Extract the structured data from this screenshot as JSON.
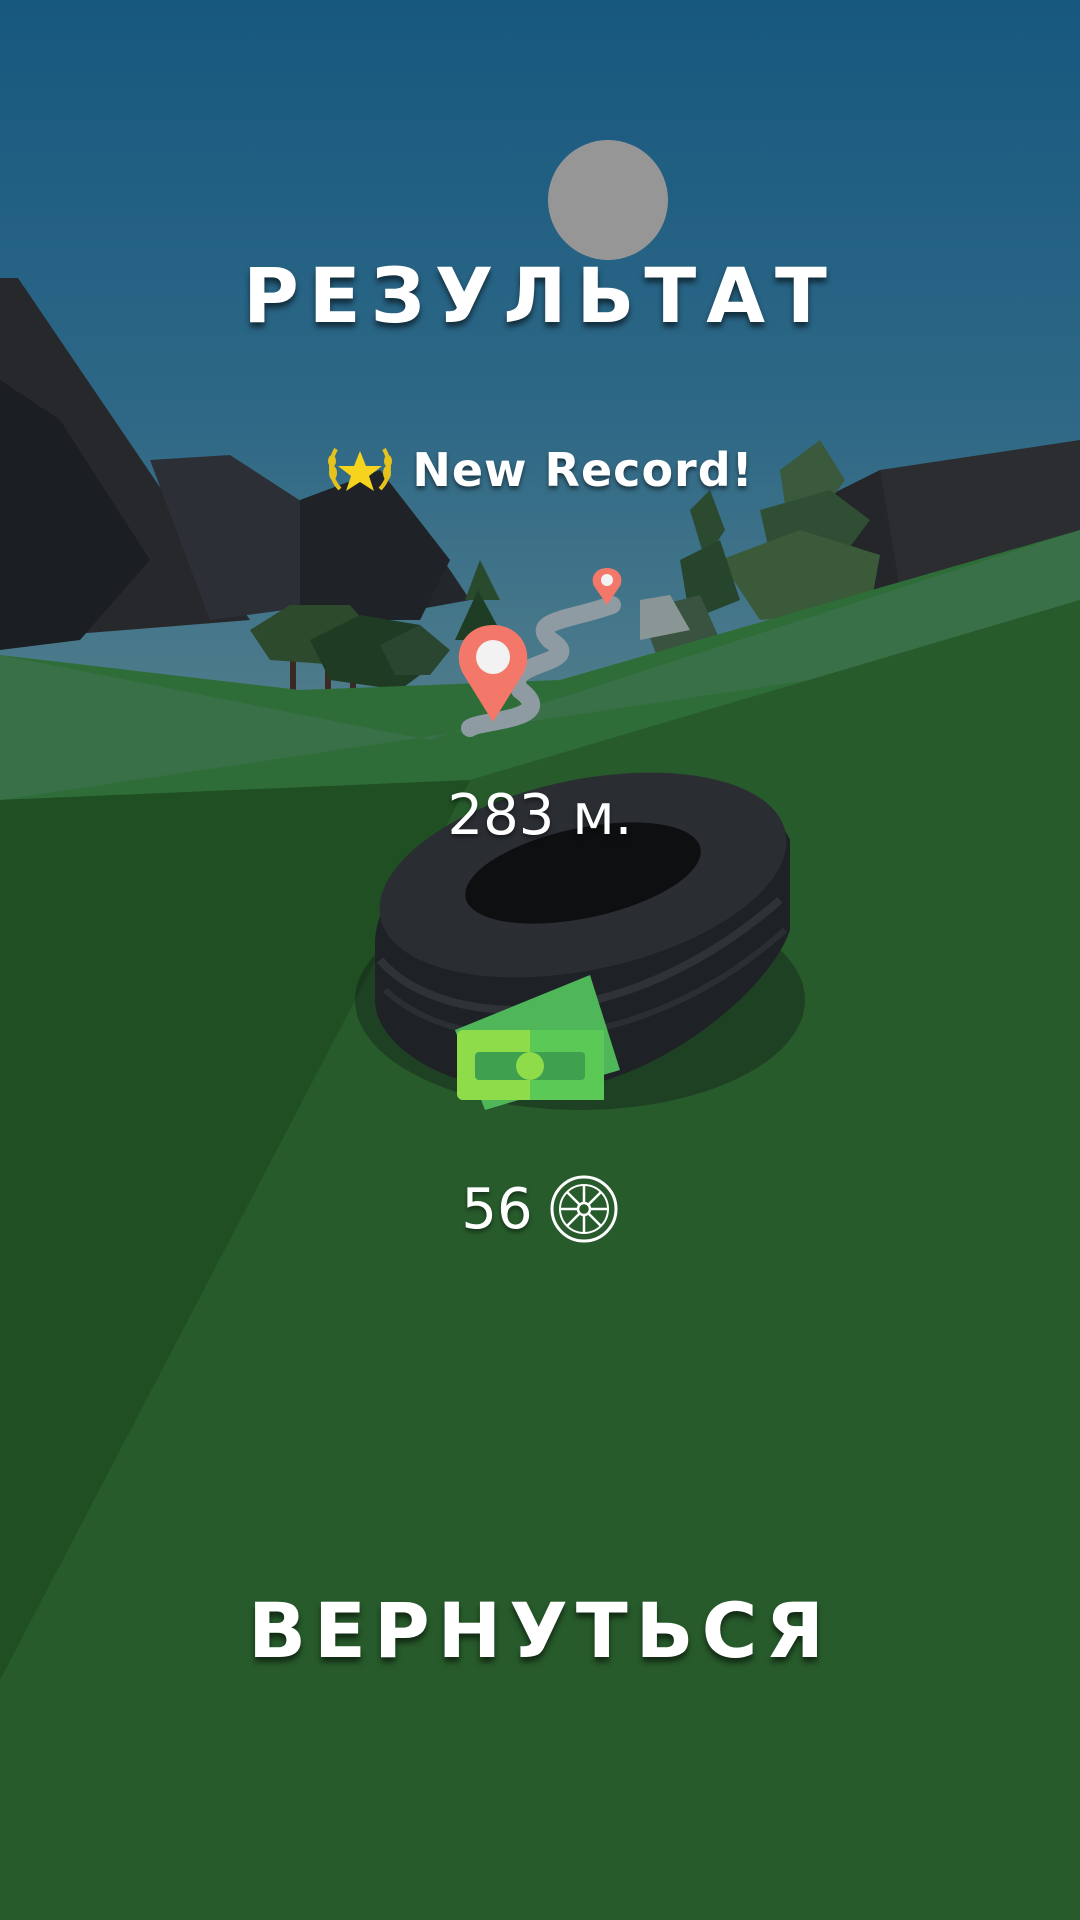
{
  "result": {
    "title": "РЕЗУЛЬТАТ",
    "new_record_label": "New Record!",
    "distance_value": "283",
    "distance_unit": "м.",
    "coins_value": "56"
  },
  "actions": {
    "back_label": "ВЕРНУТЬСЯ"
  },
  "icons": {
    "record_badge": "laurel-star-icon",
    "coin": "wheel-coin-icon",
    "map_pin": "map-pin-icon",
    "cash": "cash-icon"
  },
  "colors": {
    "sky_top": "#17587f",
    "sky_bottom": "#4f7d8c",
    "grass": "#265c2a",
    "pin": "#f4786a",
    "star": "#f6d31c",
    "cash": "#4fcf63"
  }
}
